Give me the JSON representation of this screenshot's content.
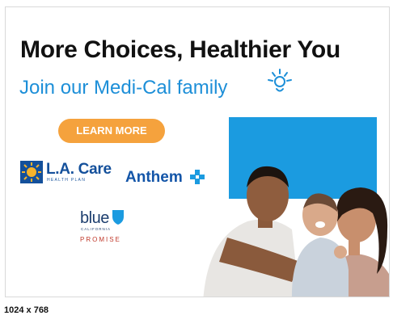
{
  "ad": {
    "headline": "More Choices, Healthier You",
    "subhead": "Join our Medi-Cal family",
    "cta_label": "LEARN MORE"
  },
  "logos": {
    "la_care": {
      "name": "L.A. Care",
      "sub": "HEALTH PLAN"
    },
    "anthem": {
      "name": "Anthem"
    },
    "blue_shield": {
      "word": "blue",
      "sub": "CALIFORNIA",
      "program": "PROMISE"
    }
  },
  "footer": {
    "size_label": "1024 x 768"
  },
  "colors": {
    "headline": "#111111",
    "accent_blue": "#1d8fd8",
    "cta_orange": "#f5a23d",
    "la_care_blue": "#14509b",
    "anthem_blue": "#1355a8",
    "blue_shield_navy": "#1d3e6e",
    "promise_red": "#c0392b",
    "photo_backdrop": "#1b9be0"
  },
  "icons": [
    "sun-smile-icon",
    "la-care-sunburst-icon",
    "anthem-cross-icon",
    "blue-shield-icon"
  ]
}
